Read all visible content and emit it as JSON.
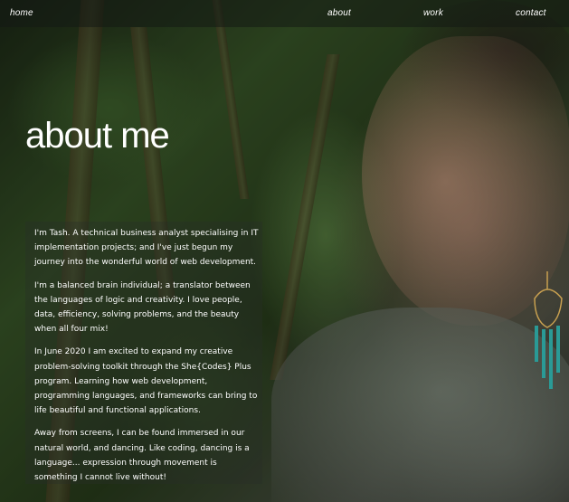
{
  "nav": {
    "home": "home",
    "about": "about",
    "work": "work",
    "contact": "contact"
  },
  "about": {
    "title": "about me",
    "paragraphs": [
      "I'm Tash. A technical business analyst specialising in IT implementation projects; and I've just begun my journey into the wonderful world of web development.",
      "I'm a balanced brain individual; a translator between the languages of logic and creativity. I love people, data, efficiency, solving problems, and the beauty when all four mix!",
      "In June 2020 I am excited to expand my creative problem-solving toolkit through the She{Codes} Plus program. Learning how web development, programming languages, and frameworks can bring to life beautiful and functional applications.",
      "Away from screens, I can be found immersed in our natural world, and dancing. Like coding, dancing is a language... expression through movement is something I cannot live without!"
    ]
  },
  "colors": {
    "text": "#ffffff",
    "navbar_bg": "rgba(20,25,20,0.55)",
    "foliage": "#3b5a2a"
  }
}
